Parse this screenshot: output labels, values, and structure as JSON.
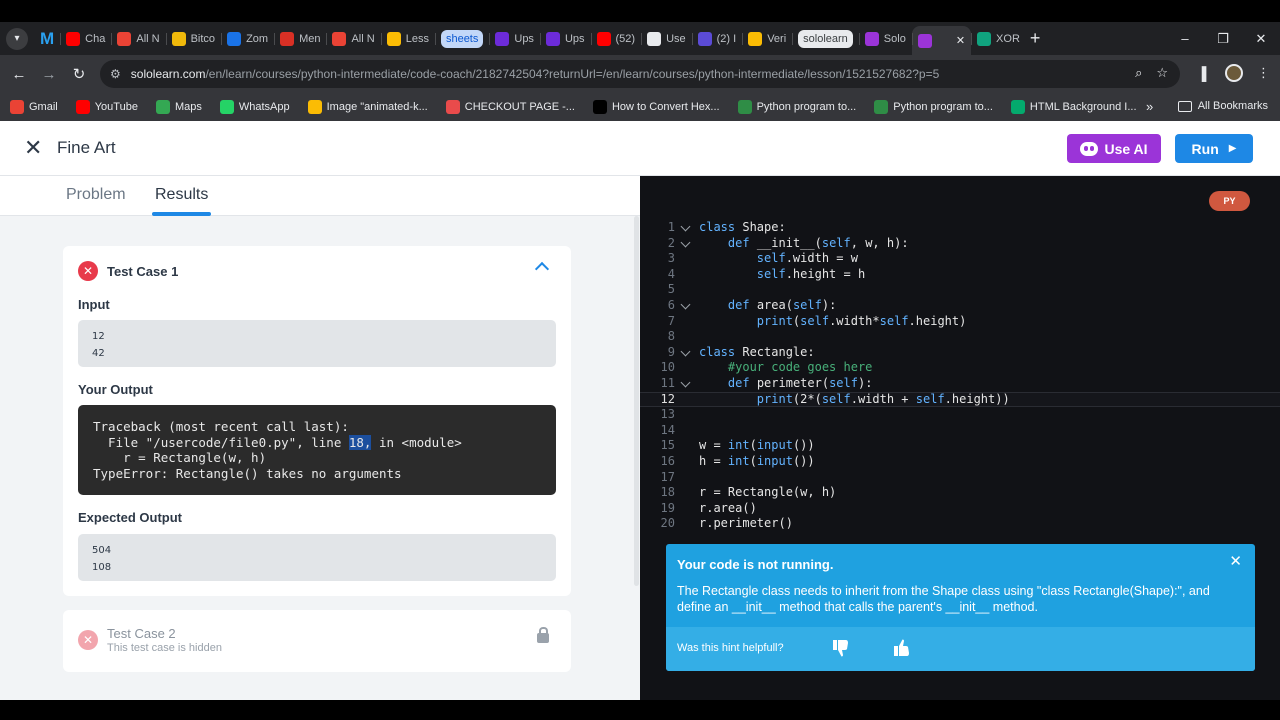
{
  "browser": {
    "tabs": [
      {
        "label": "M",
        "kind": "logo",
        "color": "#2aa0ef"
      },
      {
        "label": "Cha",
        "color": "#ff0000"
      },
      {
        "label": "All N",
        "color": "#ea4335"
      },
      {
        "label": "Bitco",
        "color": "#f0b90b"
      },
      {
        "label": "Zom",
        "color": "#1a73e8"
      },
      {
        "label": "Men",
        "color": "#d93025"
      },
      {
        "label": "All N",
        "color": "#ea4335"
      },
      {
        "label": "Less",
        "color": "#fbbc04"
      },
      {
        "label": "sheets",
        "kind": "pill"
      },
      {
        "label": "Ups",
        "color": "#6c2bd9"
      },
      {
        "label": "Ups",
        "color": "#6c2bd9"
      },
      {
        "label": "(52)",
        "color": "#ff0000"
      },
      {
        "label": "Use",
        "color": "#e8eaed"
      },
      {
        "label": "(2) I",
        "color": "#5b4bd6"
      },
      {
        "label": "Veri",
        "color": "#fbbc04"
      },
      {
        "label": "sololearn",
        "kind": "pill-gray"
      },
      {
        "label": "Solo",
        "color": "#9b34d8"
      },
      {
        "label": "",
        "kind": "active",
        "color": "#9b34d8"
      },
      {
        "label": "XOR",
        "color": "#10a37f"
      }
    ],
    "url_host": "sololearn.com",
    "url_path": "/en/learn/courses/python-intermediate/code-coach/2182742504?returnUrl=/en/learn/courses/python-intermediate/lesson/1521527682?p=5",
    "bookmarks": [
      {
        "label": "Gmail",
        "color": "#ea4335"
      },
      {
        "label": "YouTube",
        "color": "#ff0000"
      },
      {
        "label": "Maps",
        "color": "#34a853"
      },
      {
        "label": "WhatsApp",
        "color": "#25d366"
      },
      {
        "label": "Image \"animated-k...",
        "color": "#fbbc04"
      },
      {
        "label": "CHECKOUT PAGE -...",
        "color": "#e94b4b"
      },
      {
        "label": "How to Convert Hex...",
        "color": "#000000"
      },
      {
        "label": "Python program to...",
        "color": "#2f8d46"
      },
      {
        "label": "Python program to...",
        "color": "#2f8d46"
      },
      {
        "label": "HTML Background I...",
        "color": "#04aa6d"
      }
    ],
    "all_bookmarks": "All Bookmarks"
  },
  "header": {
    "title": "Fine Art",
    "use_ai": "Use AI",
    "run": "Run"
  },
  "left": {
    "tabs": [
      "Problem",
      "Results"
    ],
    "test1": {
      "title": "Test Case 1",
      "input_label": "Input",
      "input_lines": [
        "12",
        "42"
      ],
      "output_label": "Your Output",
      "output_lines": [
        "Traceback (most recent call last):",
        "  File \"/usercode/file0.py\", line ",
        "18,",
        " in <module>",
        "    r = Rectangle(w, h)",
        "TypeError: Rectangle() takes no arguments"
      ],
      "expected_label": "Expected Output",
      "expected_lines": [
        "504",
        "108"
      ]
    },
    "test2": {
      "title": "Test Case 2",
      "subtitle": "This test case is hidden"
    }
  },
  "editor": {
    "language": "PY",
    "current_line": 12,
    "lines": [
      {
        "n": "1",
        "fold": true,
        "html": "<span class='kw'>class</span> Shape:"
      },
      {
        "n": "2",
        "fold": true,
        "html": "    <span class='kw'>def</span> __init__(<span class='sf'>self</span>, w, h):"
      },
      {
        "n": "3",
        "fold": false,
        "html": "        <span class='sf'>self</span>.width = w"
      },
      {
        "n": "4",
        "fold": false,
        "html": "        <span class='sf'>self</span>.height = h"
      },
      {
        "n": "5",
        "fold": false,
        "html": ""
      },
      {
        "n": "6",
        "fold": true,
        "html": "    <span class='kw'>def</span> area(<span class='sf'>self</span>):"
      },
      {
        "n": "7",
        "fold": false,
        "html": "        <span class='bi'>print</span>(<span class='sf'>self</span>.width*<span class='sf'>self</span>.height)"
      },
      {
        "n": "8",
        "fold": false,
        "html": ""
      },
      {
        "n": "9",
        "fold": true,
        "html": "<span class='kw'>class</span> Rectangle:"
      },
      {
        "n": "10",
        "fold": false,
        "html": "    <span class='cm'>#your code goes here</span>"
      },
      {
        "n": "11",
        "fold": true,
        "html": "    <span class='kw'>def</span> perimeter(<span class='sf'>self</span>):"
      },
      {
        "n": "12",
        "fold": false,
        "html": "        <span class='bi'>print</span>(2*(<span class='sf'>self</span>.width + <span class='sf'>self</span>.height))"
      },
      {
        "n": "13",
        "fold": false,
        "html": ""
      },
      {
        "n": "14",
        "fold": false,
        "html": ""
      },
      {
        "n": "15",
        "fold": false,
        "html": "w = <span class='bi'>int</span>(<span class='bi'>input</span>())"
      },
      {
        "n": "16",
        "fold": false,
        "html": "h = <span class='bi'>int</span>(<span class='bi'>input</span>())"
      },
      {
        "n": "17",
        "fold": false,
        "html": ""
      },
      {
        "n": "18",
        "fold": false,
        "html": "r = Rectangle(w, h)"
      },
      {
        "n": "19",
        "fold": false,
        "html": "r.area()"
      },
      {
        "n": "20",
        "fold": false,
        "html": "r.perimeter()"
      }
    ]
  },
  "hint": {
    "title": "Your code is not running.",
    "body": "The Rectangle class needs to inherit from the Shape class using \"class Rectangle(Shape):\", and define an __init__ method that calls the parent's __init__ method.",
    "question": "Was this hint helpfull?"
  },
  "colors": {
    "accent": "#1e88e5",
    "ai": "#9b34d8",
    "error": "#e83a4b",
    "hint": "#1fa1e0"
  }
}
